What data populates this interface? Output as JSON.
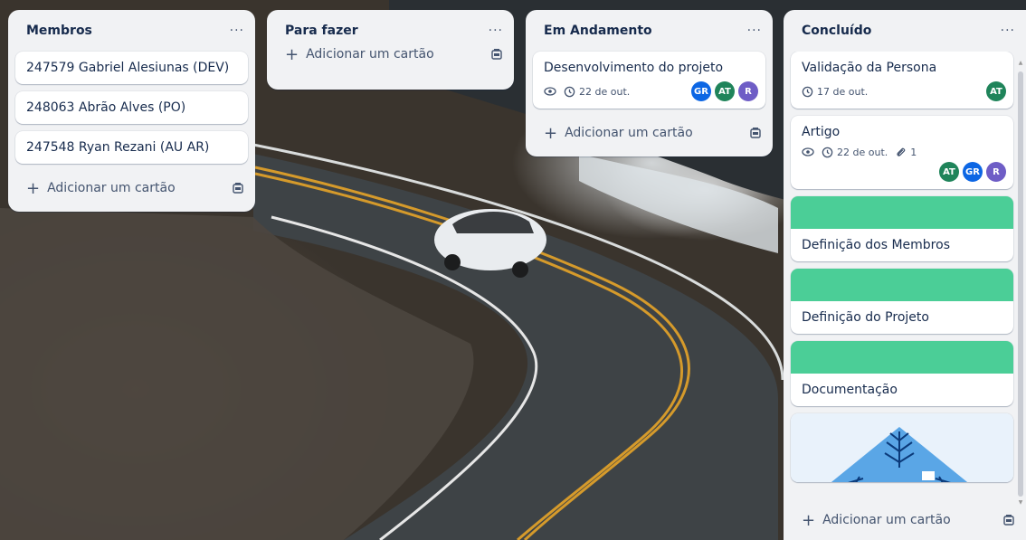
{
  "lists": [
    {
      "title": "Membros",
      "menu": "···",
      "cards": [
        {
          "title": "247579 Gabriel Alesiunas (DEV)"
        },
        {
          "title": "248063 Abrão Alves (PO)"
        },
        {
          "title": "247548 Ryan Rezani (AU AR)"
        }
      ],
      "add_label": "Adicionar um cartão"
    },
    {
      "title": "Para fazer",
      "menu": "···",
      "cards": [],
      "add_label": "Adicionar um cartão"
    },
    {
      "title": "Em Andamento",
      "menu": "···",
      "cards": [
        {
          "title": "Desenvolvimento do projeto",
          "date": "22 de out.",
          "members": [
            {
              "initials": "GR",
              "color": "#0c66e4"
            },
            {
              "initials": "AT",
              "color": "#1f845a"
            },
            {
              "initials": "R",
              "color": "#6e5dc6"
            }
          ]
        }
      ],
      "add_label": "Adicionar um cartão"
    },
    {
      "title": "Concluído",
      "menu": "···",
      "cards": [
        {
          "title": "Validação da Persona",
          "date": "17 de out.",
          "members": [
            {
              "initials": "AT",
              "color": "#1f845a"
            }
          ]
        },
        {
          "title": "Artigo",
          "date": "22 de out.",
          "attachments": "1",
          "members": [
            {
              "initials": "AT",
              "color": "#1f845a"
            },
            {
              "initials": "GR",
              "color": "#0c66e4"
            },
            {
              "initials": "R",
              "color": "#6e5dc6"
            }
          ]
        },
        {
          "title": "Definição dos Membros",
          "cover_color": "#4bce97"
        },
        {
          "title": "Definição do Projeto",
          "cover_color": "#4bce97"
        },
        {
          "title": "Documentação",
          "cover_color": "#4bce97"
        }
      ],
      "add_label": "Adicionar um cartão"
    }
  ],
  "icons": {
    "plus": "+",
    "watch": "eye-icon",
    "clock": "clock-icon",
    "attachment": "paperclip-icon",
    "template": "card-template-icon"
  },
  "colors": {
    "list_bg": "#f1f2f4",
    "cover_green": "#4bce97"
  }
}
